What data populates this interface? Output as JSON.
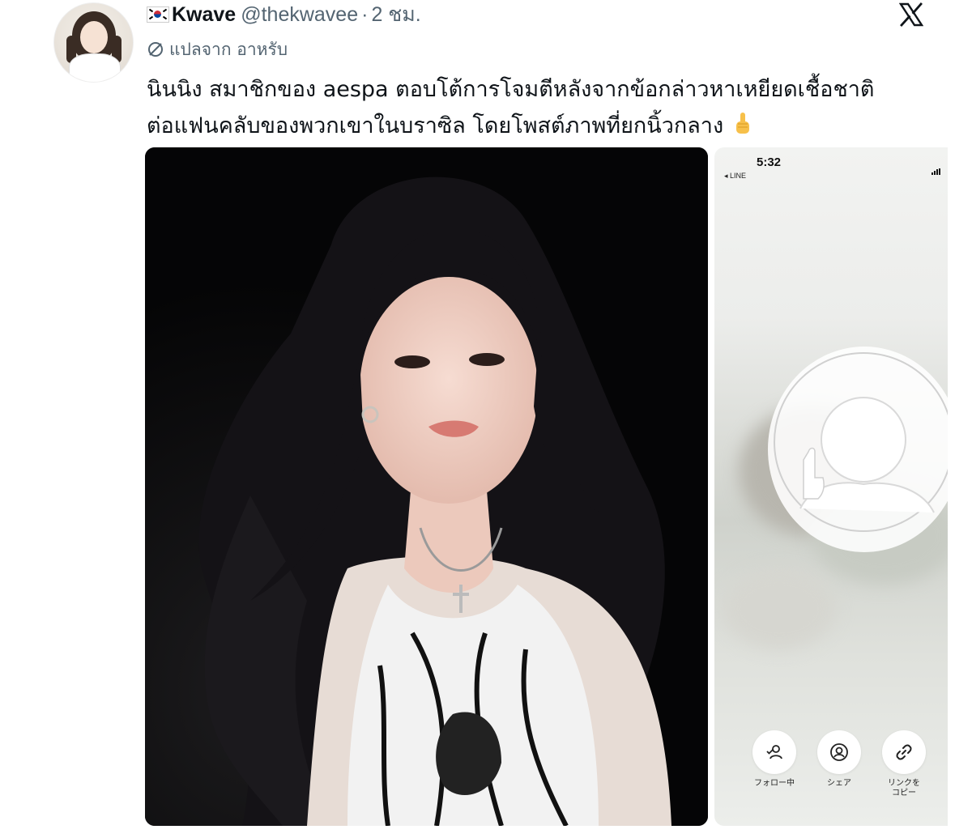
{
  "author": {
    "display_name": "Kwave",
    "handle": "@thekwavee",
    "separator": "·",
    "time": "2 ชม."
  },
  "translate_label": "แปลจาก อาหรับ",
  "tweet_text": {
    "line1": "นินนิง สมาชิกของ aespa ตอบโต้การโจมตีหลังจากข้อกล่าวหาเหยียดเชื้อชาติ",
    "line2": "ต่อแฟนคลับของพวกเขาในบราซิล โดยโพสต์ภาพที่ยกนิ้วกลาง"
  },
  "icons": {
    "flag": "south-korea-flag-icon",
    "logo": "x-logo-icon",
    "translate": "translate-globe-icon",
    "emoji": "middle-finger-emoji-icon"
  },
  "media2": {
    "status_time": "5:32",
    "back_label": "◂ LINE",
    "actions": [
      {
        "label": "フォロー中",
        "icon": "following-user-icon"
      },
      {
        "label": "シェア",
        "icon": "share-person-icon"
      },
      {
        "label": "リンクを\nコピー",
        "icon": "link-icon"
      }
    ]
  },
  "colors": {
    "text_primary": "#0f1419",
    "text_secondary": "#536471",
    "photo_background": "#050506"
  }
}
